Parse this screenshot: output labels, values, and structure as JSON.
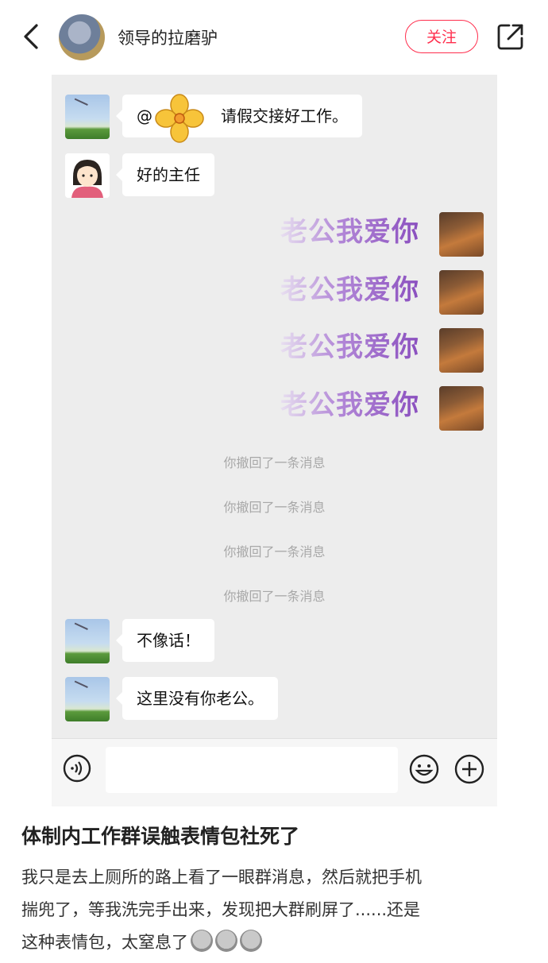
{
  "header": {
    "username": "领导的拉磨驴",
    "follow_label": "关注",
    "back_icon": "back-arrow-icon",
    "share_icon": "share-icon"
  },
  "chat": {
    "messages": [
      {
        "sender": "sky-avatar",
        "text": "请假交接好工作。",
        "mention_prefix": "@"
      },
      {
        "sender": "girl-avatar",
        "text": "好的主任"
      },
      {
        "sender": "jerry-avatar",
        "sticker_text": "老公我爱你"
      },
      {
        "sender": "jerry-avatar",
        "sticker_text": "老公我爱你"
      },
      {
        "sender": "jerry-avatar",
        "sticker_text": "老公我爱你"
      },
      {
        "sender": "jerry-avatar",
        "sticker_text": "老公我爱你"
      },
      {
        "system": "你撤回了一条消息"
      },
      {
        "system": "你撤回了一条消息"
      },
      {
        "system": "你撤回了一条消息"
      },
      {
        "system": "你撤回了一条消息"
      },
      {
        "sender": "sky-avatar",
        "text": "不像话！"
      },
      {
        "sender": "sky-avatar",
        "text": "这里没有你老公。"
      }
    ],
    "input_icons": [
      "voice-icon",
      "emoji-icon",
      "plus-icon"
    ]
  },
  "post": {
    "title": "体制内工作群误触表情包社死了",
    "description_lines": [
      "我只是去上厕所的路上看了一眼群消息，然后就把手机",
      "揣兜了，等我洗完手出来，发现把大群刷屏了......还是",
      "这种表情包，太窒息了"
    ],
    "trailing_emoji": "crying-face-emoji x3"
  },
  "colors": {
    "accent": "#ff2e4d",
    "chat_bg": "#ededed",
    "sticker": "#8a4fbf"
  }
}
